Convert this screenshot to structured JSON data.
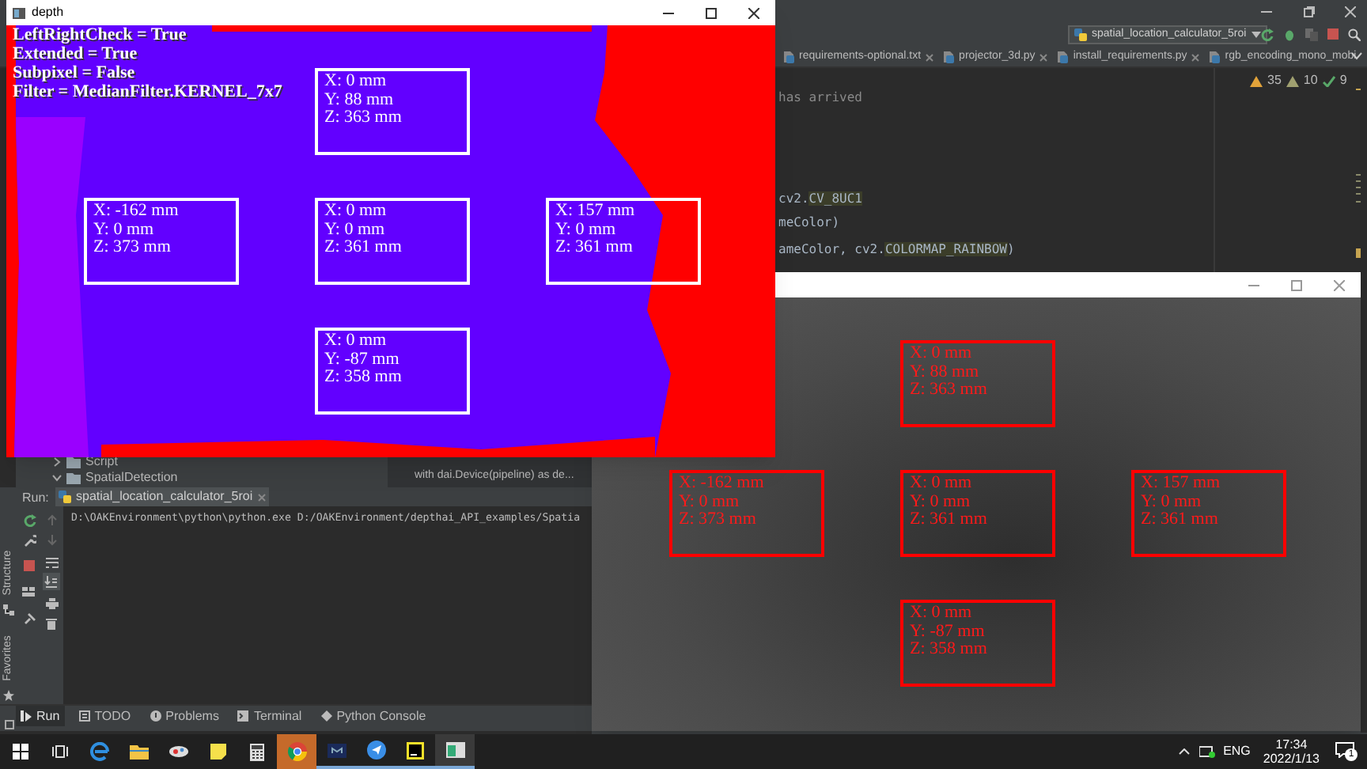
{
  "ide": {
    "run_configuration": "spatial_location_calculator_5roi",
    "editor_tabs": [
      "requirements-optional.txt",
      "projector_3d.py",
      "install_requirements.py",
      "rgb_encoding_mono_mobi"
    ],
    "inspections": {
      "warnings": "35",
      "weak_warnings": "10",
      "passed": "9"
    },
    "code_lines": [
      {
        "segments": [
          {
            "kind": "comment",
            "text": "has arrived"
          }
        ]
      },
      {
        "segments": [
          {
            "kind": "plain",
            "text": "cv2."
          },
          {
            "kind": "highlight",
            "text": "CV_8UC1"
          }
        ]
      },
      {
        "segments": [
          {
            "kind": "plain",
            "text": "meColor)"
          }
        ]
      },
      {
        "segments": [
          {
            "kind": "plain",
            "text": "ameColor, cv2."
          },
          {
            "kind": "highlight",
            "text": "COLORMAP_RAINBOW"
          },
          {
            "kind": "plain",
            "text": ")"
          }
        ]
      }
    ],
    "project_tree": [
      {
        "label": "Script",
        "expanded": false
      },
      {
        "label": "SpatialDetection",
        "expanded": true
      }
    ],
    "breadcrumb": "with dai.Device(pipeline) as de...",
    "run_panel": {
      "label": "Run:",
      "tab": "spatial_location_calculator_5roi",
      "output": "D:\\OAKEnvironment\\python\\python.exe D:/OAKEnvironment/depthai_API_examples/Spatia"
    },
    "side_tabs": [
      "Structure",
      "Favorites"
    ],
    "bottom_tabs": [
      {
        "label": "Run",
        "selected": true
      },
      {
        "label": "TODO",
        "selected": false
      },
      {
        "label": "Problems",
        "selected": false
      },
      {
        "label": "Terminal",
        "selected": false
      },
      {
        "label": "Python Console",
        "selected": false
      }
    ]
  },
  "depth_window": {
    "title": "depth",
    "settings": [
      "LeftRightCheck = True",
      "Extended = True",
      "Subpixel = False",
      "Filter = MedianFilter.KERNEL_7x7"
    ],
    "rois": [
      {
        "lines": [
          "X: 0 mm",
          "Y: 88 mm",
          "Z: 363 mm"
        ]
      },
      {
        "lines": [
          "X: -162 mm",
          "Y: 0 mm",
          "Z: 373 mm"
        ]
      },
      {
        "lines": [
          "X: 0 mm",
          "Y: 0 mm",
          "Z: 361 mm"
        ]
      },
      {
        "lines": [
          "X: 157 mm",
          "Y: 0 mm",
          "Z: 361 mm"
        ]
      },
      {
        "lines": [
          "X: 0 mm",
          "Y: -87 mm",
          "Z: 358 mm"
        ]
      }
    ]
  },
  "camera_window": {
    "rois": [
      {
        "lines": [
          "X: 0 mm",
          "Y: 88 mm",
          "Z: 363 mm"
        ]
      },
      {
        "lines": [
          "X: -162 mm",
          "Y: 0 mm",
          "Z: 373 mm"
        ]
      },
      {
        "lines": [
          "X: 0 mm",
          "Y: 0 mm",
          "Z: 361 mm"
        ]
      },
      {
        "lines": [
          "X: 157 mm",
          "Y: 0 mm",
          "Z: 361 mm"
        ]
      },
      {
        "lines": [
          "X: 0 mm",
          "Y: -87 mm",
          "Z: 358 mm"
        ]
      }
    ]
  },
  "taskbar": {
    "language": "ENG",
    "time": "17:34",
    "date": "2022/1/13",
    "notifications": "1"
  }
}
